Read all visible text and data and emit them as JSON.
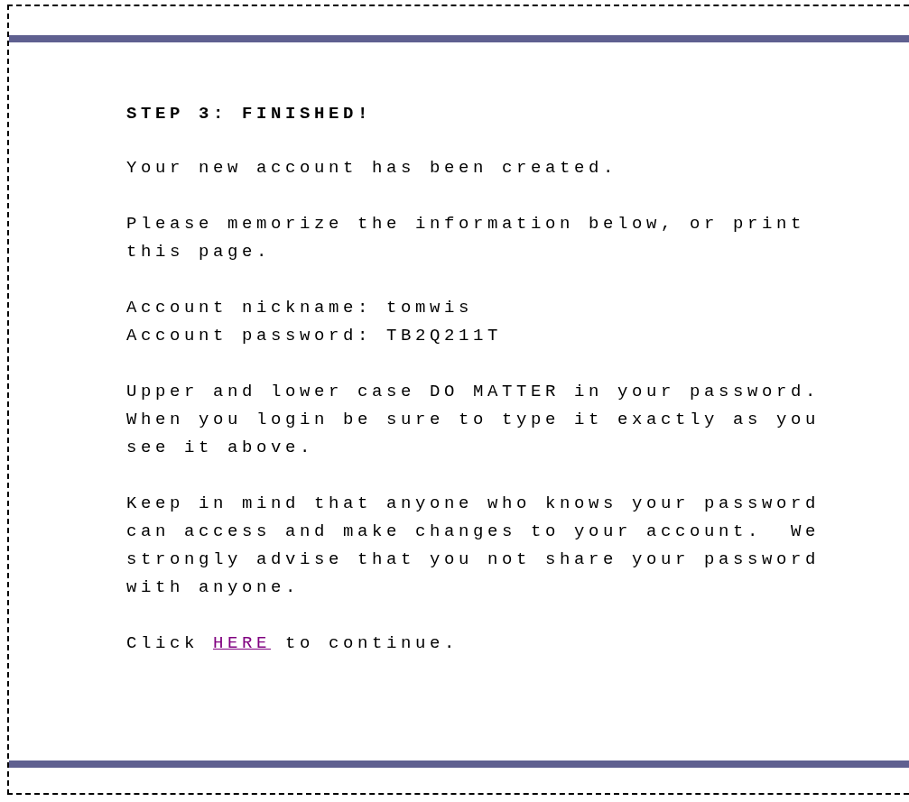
{
  "heading": "STEP 3: FINISHED!",
  "blocks": [
    {
      "kind": "text",
      "text": "Your new account has been created."
    },
    {
      "kind": "text",
      "text": "Please memorize the information below, or print this page."
    },
    {
      "kind": "lines",
      "lines": [
        "Account nickname: tomwis",
        "Account password: TB2Q211T"
      ]
    },
    {
      "kind": "text",
      "text": "Upper and lower case DO MATTER in your password. When you login be sure to type it exactly as you see it above."
    },
    {
      "kind": "text",
      "text": "Keep in mind that anyone who knows your password can access and make changes to your account.  We strongly advise that you not share your password with anyone."
    },
    {
      "kind": "link_line",
      "before": "Click ",
      "link": "HERE",
      "after": " to continue."
    }
  ]
}
